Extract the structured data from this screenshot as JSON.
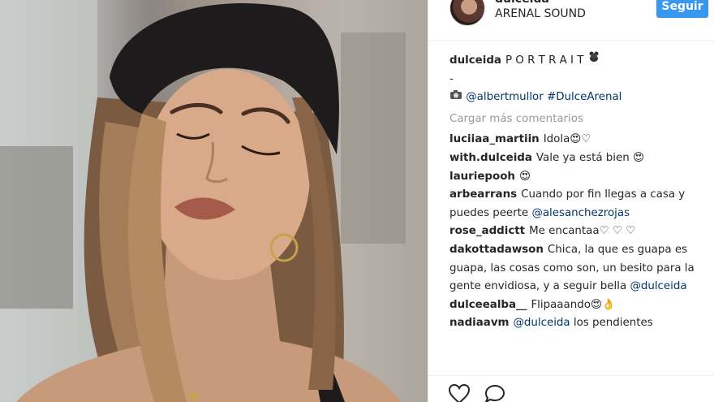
{
  "post": {
    "author": "dulceida",
    "location": "ARENAL SOUND",
    "follow_label": "Seguir"
  },
  "caption": {
    "user": "dulceida",
    "text": "P O R T R A I T",
    "dash": "-",
    "credit_mention": "@albertmullor",
    "hashtag": "#DulceArenal"
  },
  "load_more_label": "Cargar más comentarios",
  "comments": [
    {
      "user": "luciiaa_martiin",
      "text": "Idola😍♡"
    },
    {
      "user": "with.dulceida",
      "text": "Vale ya está bien 😍"
    },
    {
      "user": "lauriepooh",
      "text": "😍"
    },
    {
      "user": "arbearrans",
      "text": "Cuando por fin llegas a casa y puedes peerte",
      "mention": "@alesanchezrojas"
    },
    {
      "user": "rose_addictt",
      "text": "Me encantaa♡ ♡ ♡"
    },
    {
      "user": "dakottadawson",
      "text": "Chica, la que es guapa es guapa, las cosas como son, un besito para la gente envidiosa, y a seguir bella",
      "mention": "@dulceida"
    },
    {
      "user": "dulceealba__",
      "text": "Flipaaando😍👌"
    },
    {
      "user": "nadiaavm",
      "mention": "@dulceida",
      "text": "los pendientes"
    }
  ],
  "icons": {
    "like": "heart-icon",
    "comment": "comment-icon",
    "camera": "camera-icon",
    "dog": "dog-icon"
  },
  "colors": {
    "follow_button": "#3897f0",
    "mention": "#003569",
    "muted": "#999999"
  }
}
